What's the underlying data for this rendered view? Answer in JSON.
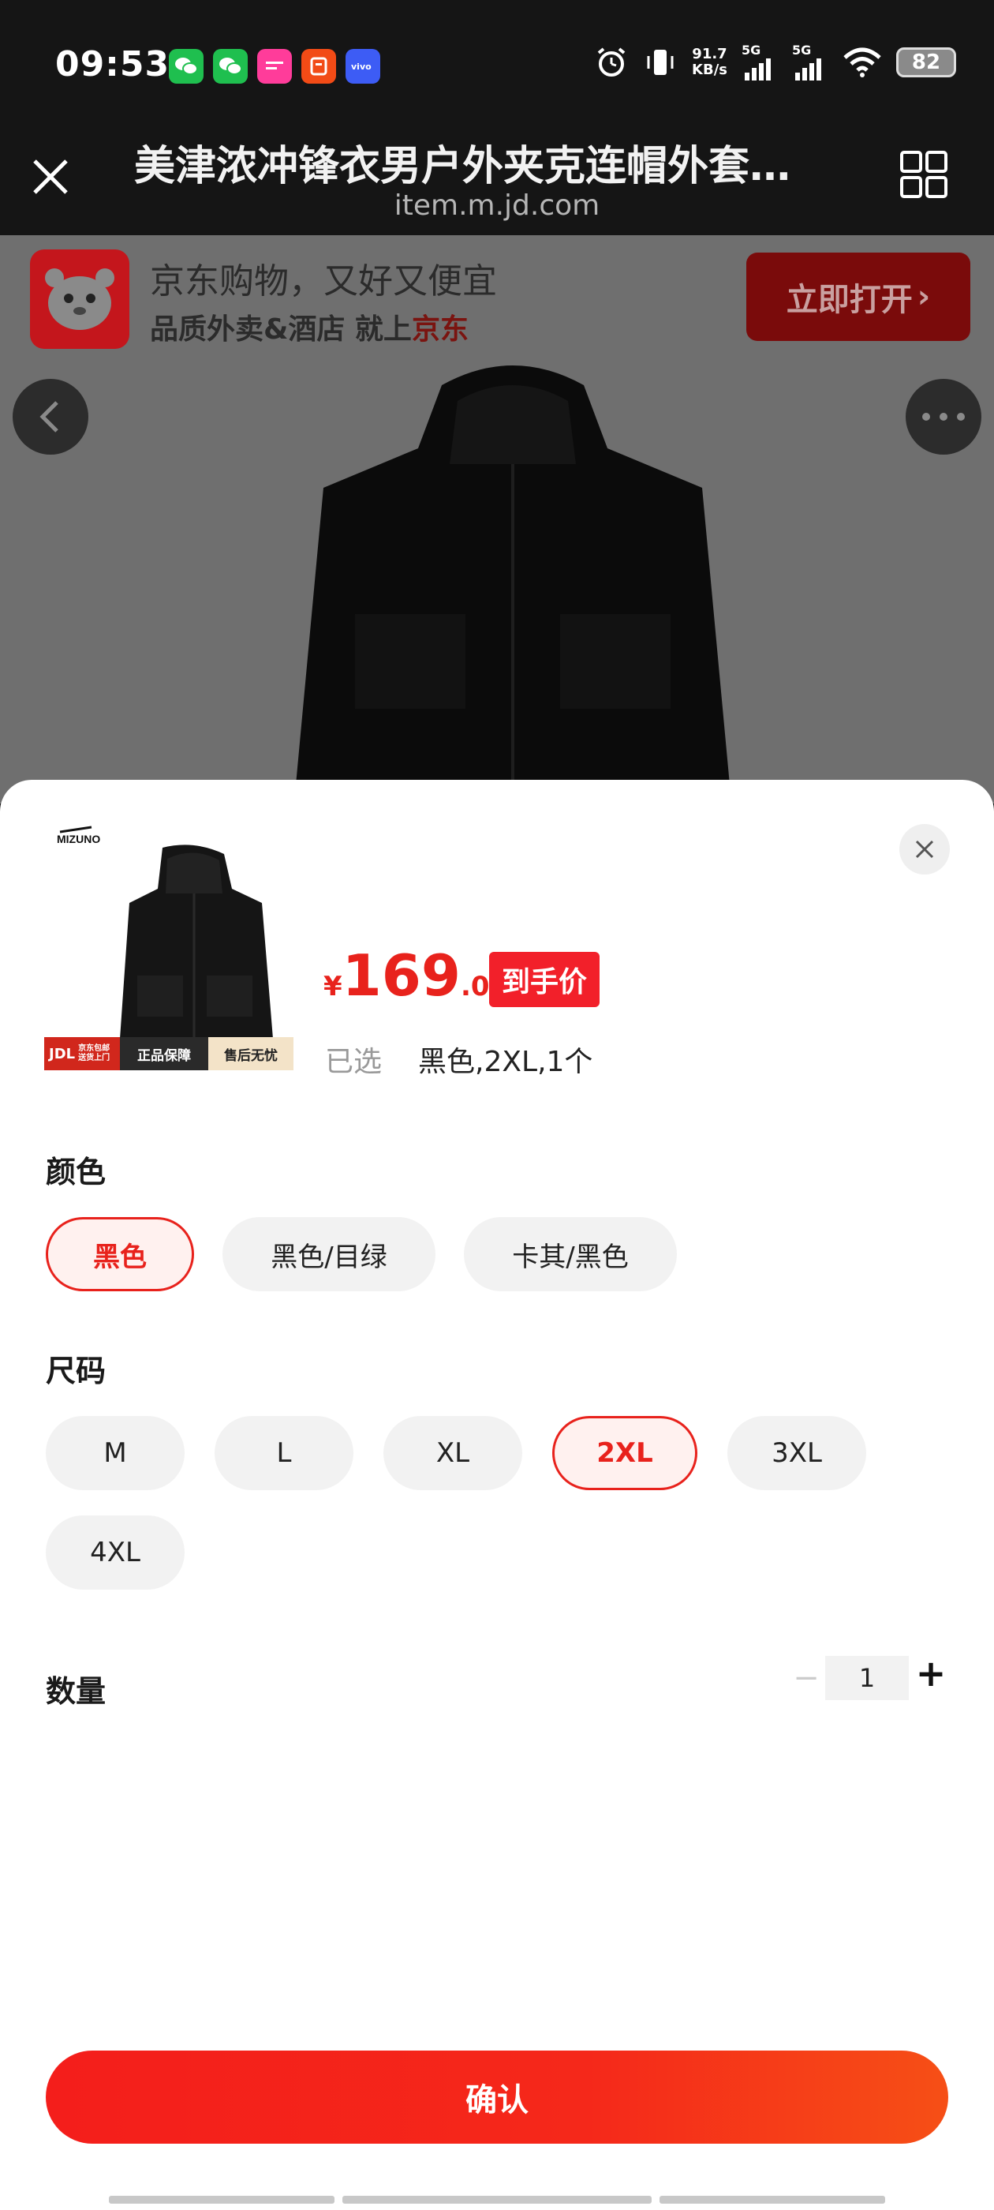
{
  "status_bar": {
    "time": "09:53",
    "app_icons": [
      "wechat-icon",
      "wechat-icon",
      "vipshop-icon",
      "manman-icon",
      "vivo-icon"
    ],
    "app_icon_colors": [
      "#1fbf4f",
      "#1fbf4f",
      "#ff3c9a",
      "#f24b16",
      "#3d5cf5"
    ],
    "net_speed_value": "91.7",
    "net_speed_unit": "KB/s",
    "signal1_label": "5G",
    "signal2_label": "5G",
    "battery": "82"
  },
  "title_bar": {
    "title": "美津浓冲锋衣男户外夹克连帽外套…",
    "url": "item.m.jd.com"
  },
  "background_page": {
    "banner_line1": "京东购物，又好又便宜",
    "banner_line2_prefix": "品质外卖&酒店 就上",
    "banner_line2_brand": "京东",
    "open_button": "立即打开"
  },
  "sheet": {
    "price_currency": "¥",
    "price_integer": "169",
    "price_decimal": ".00",
    "price_tag": "到手价",
    "selected_label": "已选",
    "selected_value": "黑色,2XL,1个",
    "badges": {
      "jdl": "JDL",
      "jdl_sub1": "京东包邮",
      "jdl_sub2": "送货上门",
      "genuine": "正品保障",
      "aftersale": "售后无忧"
    },
    "brand": "MIZUNO",
    "color_title": "颜色",
    "colors": [
      {
        "label": "黑色",
        "selected": true
      },
      {
        "label": "黑色/目绿",
        "selected": false
      },
      {
        "label": "卡其/黑色",
        "selected": false
      }
    ],
    "size_title": "尺码",
    "sizes": [
      {
        "label": "M",
        "selected": false
      },
      {
        "label": "L",
        "selected": false
      },
      {
        "label": "XL",
        "selected": false
      },
      {
        "label": "2XL",
        "selected": true
      },
      {
        "label": "3XL",
        "selected": false
      },
      {
        "label": "4XL",
        "selected": false
      }
    ],
    "quantity_title": "数量",
    "quantity": "1",
    "quantity_minus": "−",
    "quantity_plus": "+",
    "confirm_button": "确认"
  }
}
